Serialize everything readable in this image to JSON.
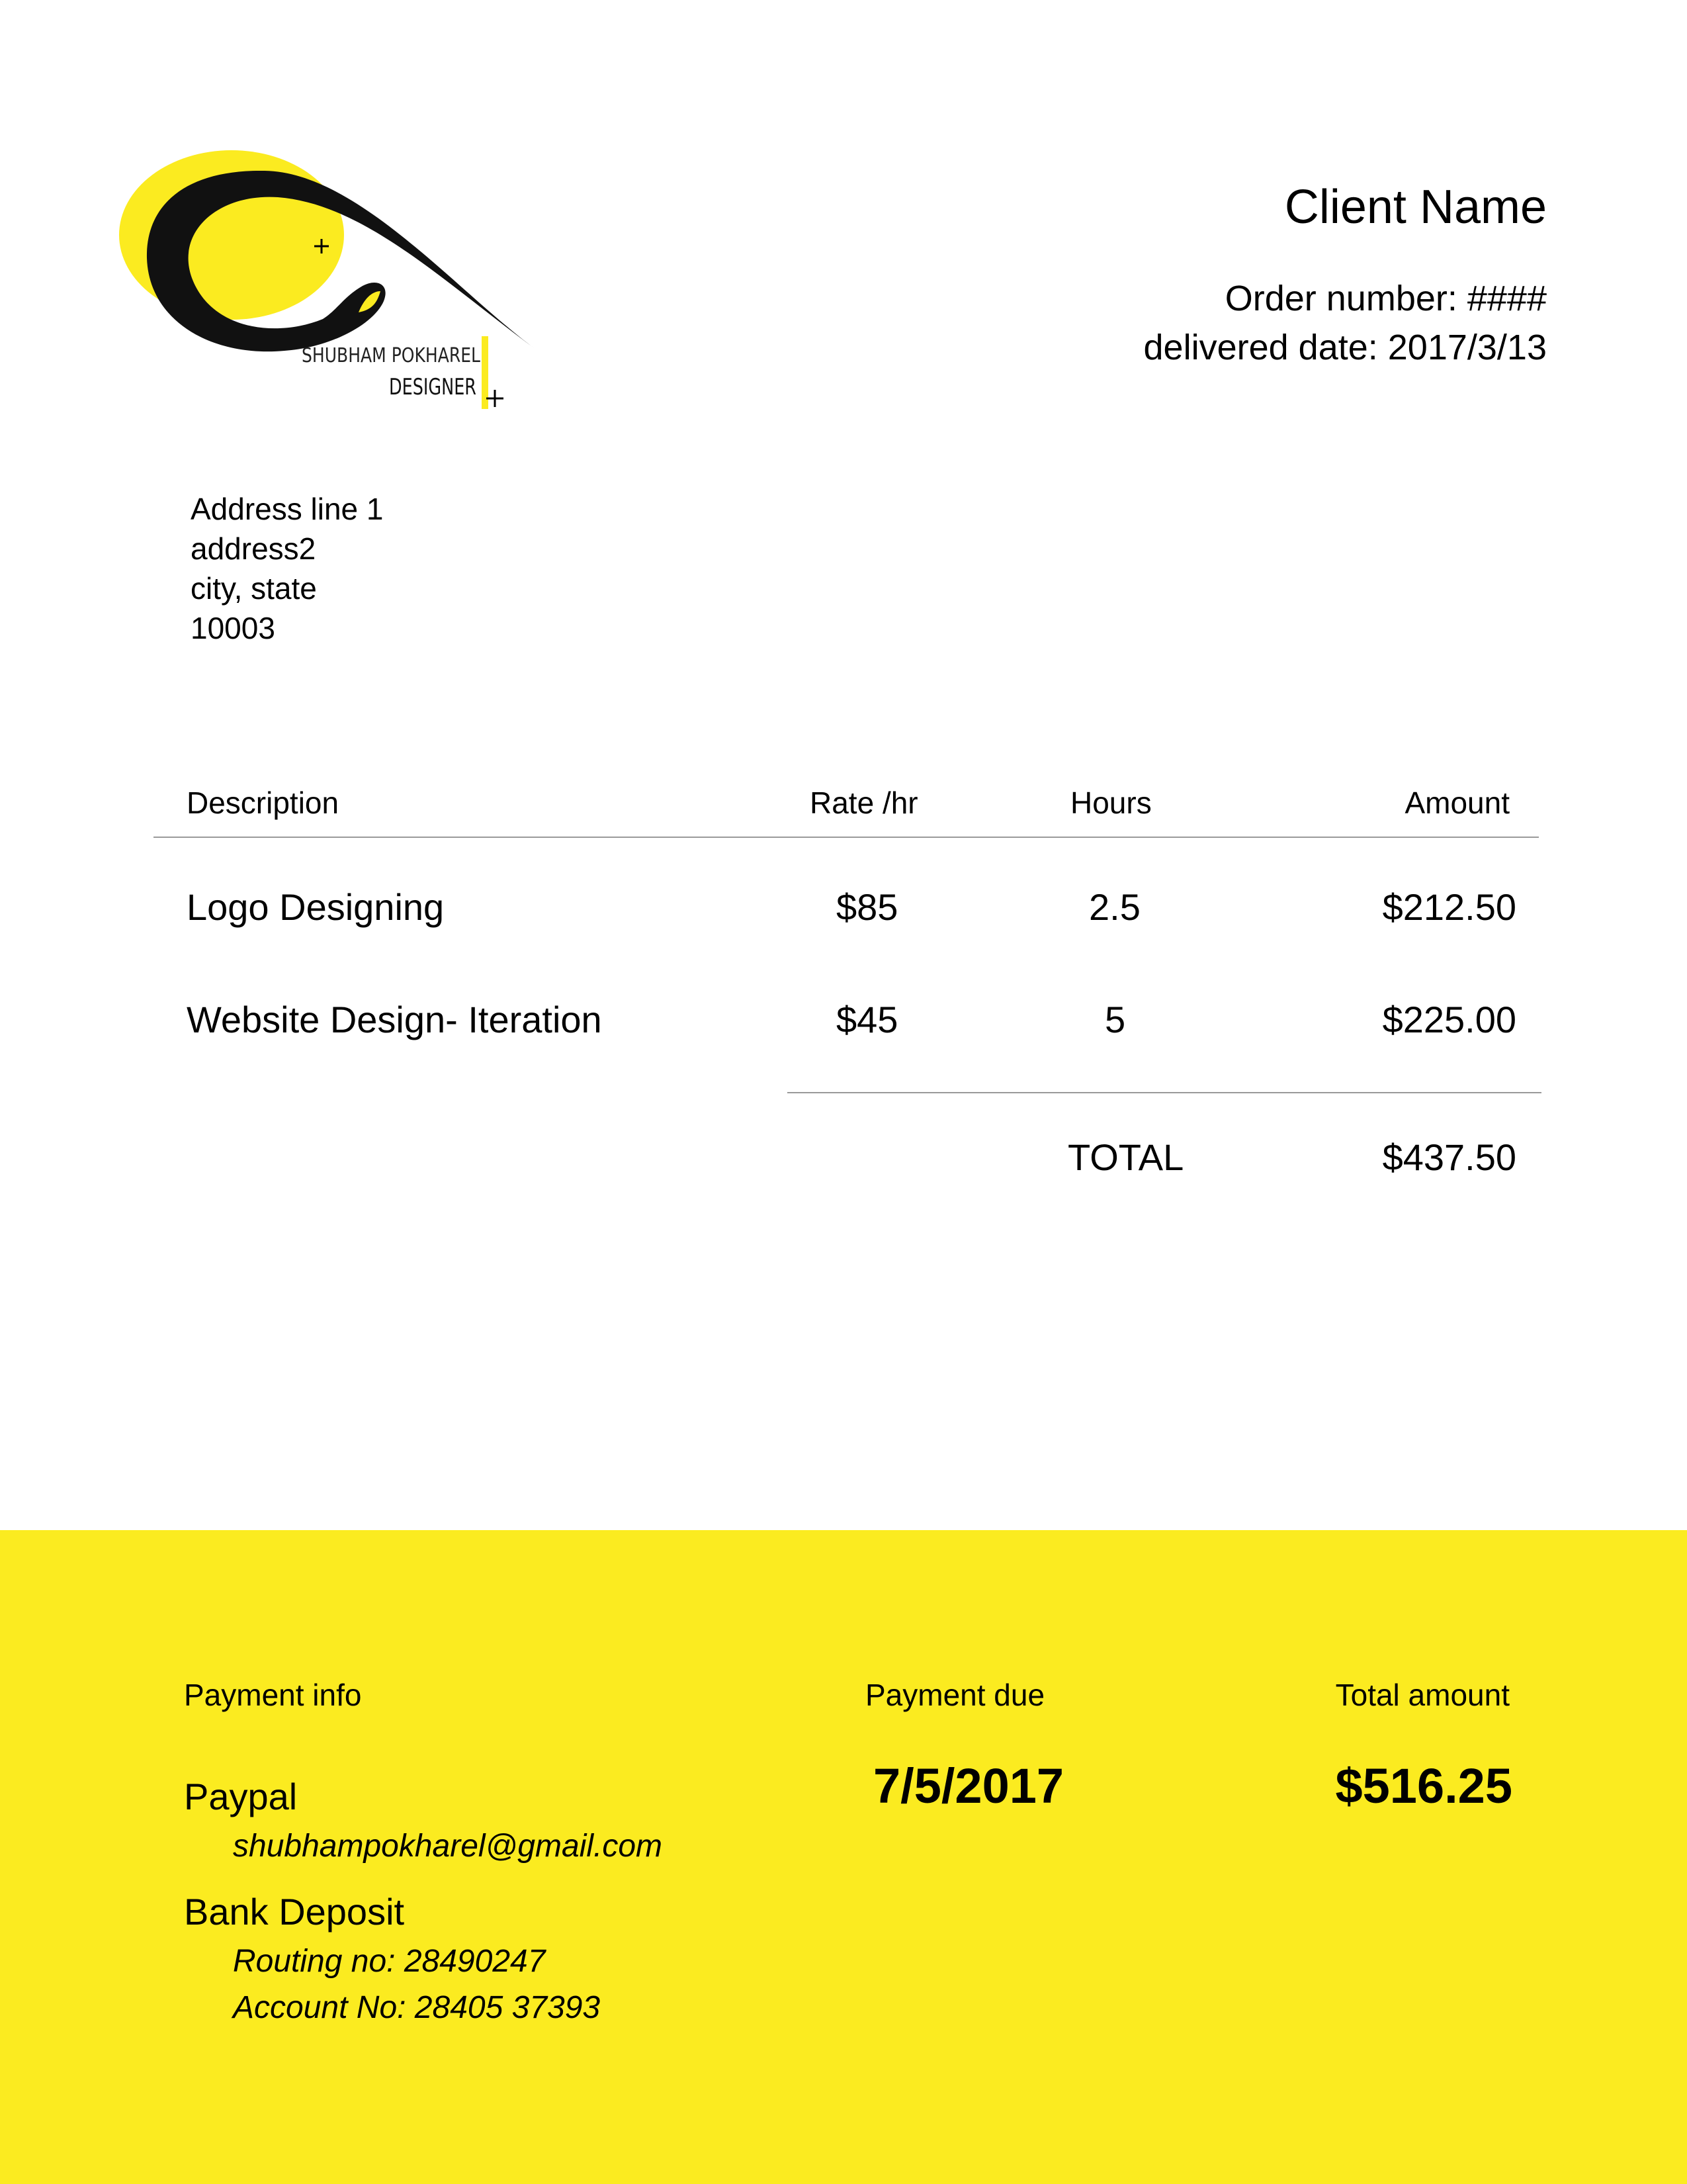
{
  "brand": {
    "logo_line1": "SHUBHAM POKHAREL",
    "logo_line2": "DESIGNER",
    "accent_color": "#fbeb20"
  },
  "header": {
    "client_name": "Client Name",
    "order_number": "Order number: ####",
    "delivered_date": "delivered date: 2017/3/13"
  },
  "address": {
    "line1": "Address line 1",
    "line2": "address2",
    "line3": "city, state",
    "line4": "10003"
  },
  "table": {
    "headers": [
      "Description",
      "Rate /hr",
      "Hours",
      "Amount"
    ],
    "rows": [
      {
        "description": "Logo Designing",
        "rate": "$85",
        "hours": "2.5",
        "amount": "$212.50"
      },
      {
        "description": "Website Design- Iteration",
        "rate": "$45",
        "hours": "5",
        "amount": "$225.00"
      }
    ],
    "total_label": "TOTAL",
    "total_value": "$437.50"
  },
  "footer": {
    "payment_info_label": "Payment info",
    "payment_due_label": "Payment due",
    "total_amount_label": "Total amount",
    "methods": [
      {
        "name": "Paypal",
        "details": [
          "shubhampokharel@gmail.com"
        ]
      },
      {
        "name": "Bank Deposit",
        "details": [
          "Routing no: 28490247",
          "Account No: 28405 37393"
        ]
      }
    ],
    "payment_due": "7/5/2017",
    "total_amount": "$516.25"
  }
}
